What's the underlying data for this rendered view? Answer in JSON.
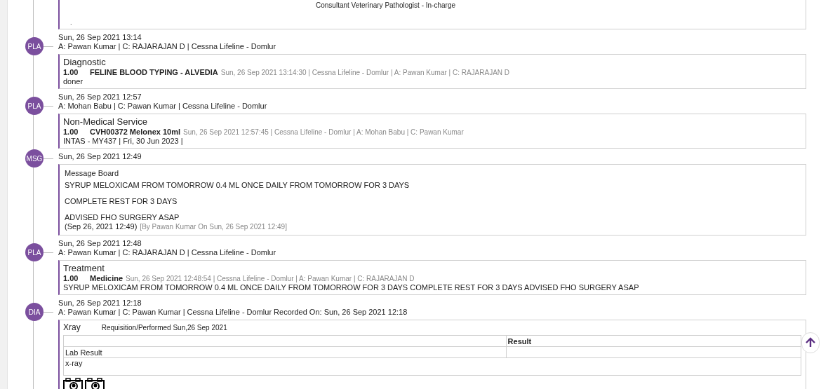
{
  "top_card": {
    "signature": "Consultant Veterinary Pathologist - In-charge",
    "note": "."
  },
  "entries": [
    {
      "kind": "service",
      "badge": "PLA",
      "date": "Sun, 26 Sep 2021 13:14",
      "byline": "A: Pawan Kumar | C: RAJARAJAN D | Cessna Lifeline - Domlur",
      "title": "Diagnostic",
      "qty": "1.00",
      "item": "FELINE BLOOD TYPING - ALVEDIA",
      "meta": "Sun, 26 Sep 2021 13:14:30 | Cessna Lifeline - Domlur | A: Pawan Kumar | C: RAJARAJAN D",
      "note": "doner"
    },
    {
      "kind": "service",
      "badge": "PLA",
      "date": "Sun, 26 Sep 2021 12:57",
      "byline": "A: Mohan Babu | C: Pawan Kumar | Cessna Lifeline - Domlur",
      "title": "Non-Medical Service",
      "qty": "1.00",
      "item": "CVH00372 Melonex 10ml",
      "meta": "Sun, 26 Sep 2021 12:57:45 | Cessna Lifeline - Domlur | A: Mohan Babu | C: Pawan Kumar",
      "note": "INTAS - MY437 | Fri, 30 Jun 2023 |"
    },
    {
      "kind": "message",
      "badge": "MSG",
      "date": "Sun, 26 Sep 2021 12:49",
      "title": "Message Board",
      "lines": [
        "SYRUP MELOXICAM FROM TOMORROW 0.4 ML ONCE DAILY FROM TOMORROW FOR 3 DAYS",
        "COMPLETE REST FOR 3 DAYS",
        "ADVISED FHO SURGERY ASAP"
      ],
      "stamp": "(Sep 26, 2021 12:49)",
      "meta": "[By Pawan Kumar On  Sun, 26 Sep 2021 12:49]"
    },
    {
      "kind": "service",
      "badge": "PLA",
      "date": "Sun, 26 Sep 2021 12:48",
      "byline": "A: Pawan Kumar | C: RAJARAJAN D | Cessna Lifeline - Domlur",
      "title": "Treatment",
      "qty": "1.00",
      "item": "Medicine",
      "meta": "Sun, 26 Sep 2021 12:48:54 | Cessna Lifeline - Domlur | A: Pawan Kumar | C: RAJARAJAN D",
      "note": "SYRUP MELOXICAM FROM TOMORROW 0.4 ML ONCE DAILY FROM TOMORROW FOR 3 DAYS COMPLETE REST FOR 3 DAYS ADVISED FHO SURGERY ASAP"
    },
    {
      "kind": "lab",
      "badge": "DIA",
      "date": "Sun, 26 Sep 2021 12:18",
      "byline": "A: Pawan Kumar | C: Pawan Kumar | Cessna Lifeline - Domlur Recorded On: Sun, 26 Sep 2021 12:18",
      "title": "Xray",
      "requisition": "Requisition/Performed Sun,26 Sep 2021",
      "result_header": "Result",
      "row_label": "Lab Result",
      "finding": "x-ray",
      "attachments": [
        {
          "kind": "camera"
        },
        {
          "kind": "camera"
        }
      ]
    }
  ]
}
